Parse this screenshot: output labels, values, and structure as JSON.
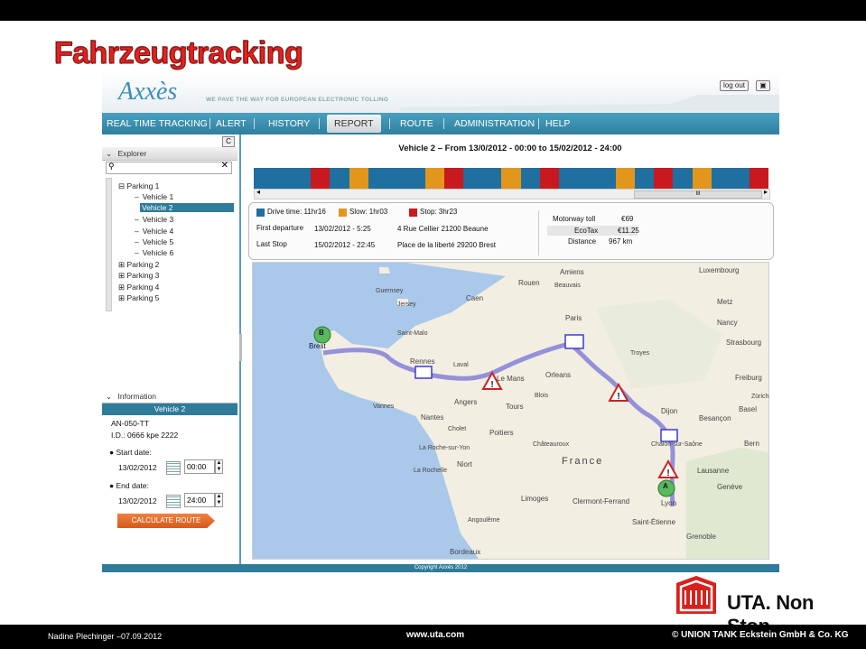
{
  "slide": {
    "title": "Fahrzeugtracking",
    "footer_left": "Nadine Plechinger –07.09.2012",
    "footer_mid": "www.uta.com",
    "footer_right": "© UNION TANK Eckstein GmbH & Co. KG",
    "brand_text": "UTA. Non Stop."
  },
  "app": {
    "logo": "Axxès",
    "tagline": "WE PAVE THE WAY FOR EUROPEAN ELECTRONIC TOLLING",
    "logout_label": "log out",
    "print_icon": "print-icon",
    "copyright": "Copyright Axxès 2012"
  },
  "nav": {
    "items": [
      "REAL TIME TRACKING",
      "ALERT",
      "HISTORY",
      "REPORT",
      "ROUTE",
      "ADMINISTRATION",
      "HELP"
    ],
    "active": "REPORT"
  },
  "explorer": {
    "title": "Explorer",
    "search_placeholder": "",
    "parking1": "Parking 1",
    "vehicles": [
      "Vehicle 1",
      "Vehicle 2",
      "Vehicle 3",
      "Vehicle 4",
      "Vehicle 5",
      "Vehicle 6"
    ],
    "selected_vehicle": "Vehicle 2",
    "parkings": [
      "Parking 2",
      "Parking 3",
      "Parking 4",
      "Parking 5"
    ]
  },
  "information": {
    "title": "Information",
    "vehicle": "Vehicle 2",
    "plate": "AN-050-TT",
    "id_label": "I.D.:",
    "id_value": "0666 kpe 2222",
    "start_label": "Start date:",
    "start_date": "13/02/2012",
    "start_time": "00:00",
    "end_label": "End date:",
    "end_date": "13/02/2012",
    "end_time": "24:00",
    "calc_button": "CALCULATE ROUTE"
  },
  "report": {
    "title": "Vehicle 2 – From 13/0/2012 - 00:00 to 15/02/2012 - 24:00",
    "legend": [
      {
        "label": "Drive time: 11hr16",
        "color": "#1f6fa0"
      },
      {
        "label": "Slow: 1hr03",
        "color": "#e3961c"
      },
      {
        "label": "Stop: 3hr23",
        "color": "#c8191e"
      }
    ],
    "first_departure_label": "First departure",
    "first_departure_time": "13/02/2012 - 5:25",
    "first_departure_place": "4 Rue Cellier 21200 Beaune",
    "last_stop_label": "Last Stop",
    "last_stop_time": "15/02/2012 - 22:45",
    "last_stop_place": "Place de la liberté 29200 Brest",
    "motorway_label": "Motorway toll",
    "motorway_value": "€69",
    "ecotax_label": "EcoTax",
    "ecotax_value": "€11.25",
    "distance_label": "Distance",
    "distance_value": "967 km",
    "scroll_thumb": "III"
  },
  "map": {
    "marker_b": "B",
    "marker_a": "A",
    "labels": [
      "Amiens",
      "Luxembourg",
      "Guernsey",
      "Jersey",
      "Rouen",
      "Beauvais",
      "Metz",
      "Caen",
      "Saint-Malo",
      "Paris",
      "Nancy",
      "Strasbourg",
      "Brest",
      "Rennes",
      "Laval",
      "Le Mans",
      "Orleans",
      "Troyes",
      "Freiburg",
      "Vannes",
      "Angers",
      "Tours",
      "Blois",
      "Dijon",
      "Besançon",
      "Basel",
      "Zürich",
      "Nantes",
      "Cholet",
      "Poitiers",
      "Chalon-sur-Saône",
      "Bern",
      "La Roche-sur-Yon",
      "Châteauroux",
      "Niort",
      "France",
      "Lausanne",
      "La Rochelle",
      "Limoges",
      "Clermont-Ferrand",
      "Genève",
      "Lyon",
      "Saint-Étienne",
      "Grenoble",
      "Bordeaux",
      "Angoulême"
    ]
  }
}
